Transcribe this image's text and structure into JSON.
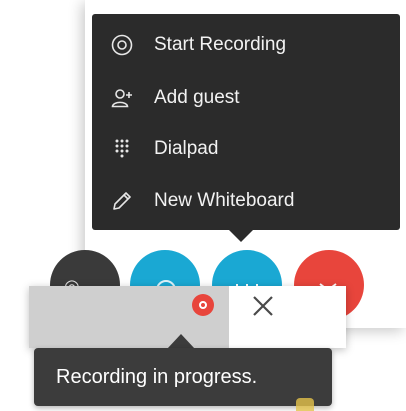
{
  "menu": {
    "items": [
      {
        "label": "Start Recording",
        "icon": "record-icon"
      },
      {
        "label": "Add guest",
        "icon": "add-user-icon"
      },
      {
        "label": "Dialpad",
        "icon": "dialpad-icon"
      },
      {
        "label": "New Whiteboard",
        "icon": "pencil-icon"
      }
    ]
  },
  "recording": {
    "tooltip": "Recording in progress.",
    "indicator_icon": "recording-indicator-icon",
    "close_icon": "close-icon"
  },
  "colors": {
    "menu_bg": "#2b2b2b",
    "accent_cyan": "#1aa8d3",
    "hangup_red": "#e8453c",
    "tooltip_bg": "#3c3c3c"
  }
}
